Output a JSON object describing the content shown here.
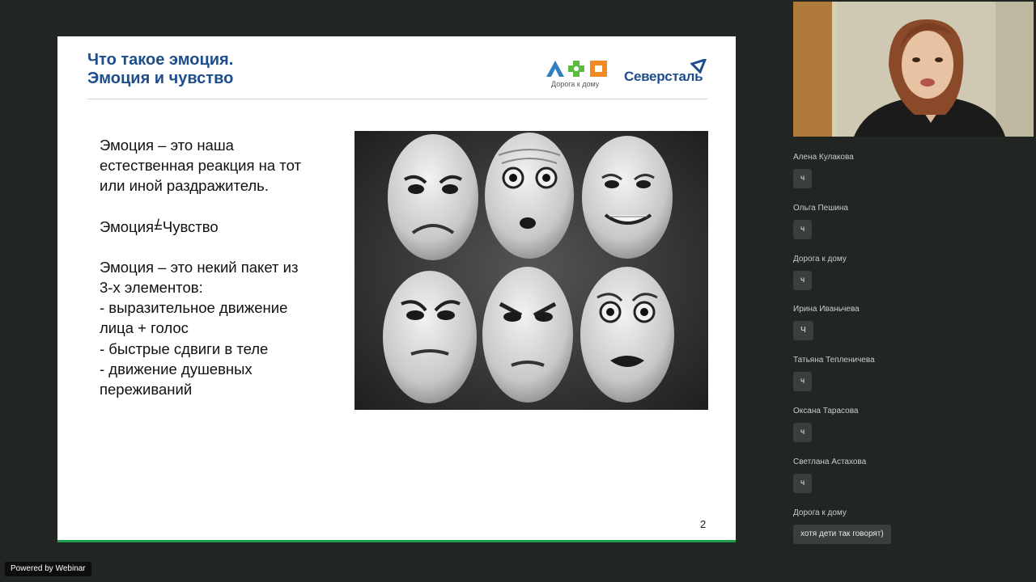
{
  "slide": {
    "title_line1": "Что такое эмоция.",
    "title_line2": "Эмоция и чувство",
    "logo_dkd_caption": "Дорога к дому",
    "logo_severstal": "Северсталь",
    "body": {
      "p1": [
        "Эмоция – это наша",
        "естественная реакция на тот",
        "или иной раздражитель."
      ],
      "p2_left": "Эмоция",
      "p2_sign": "=",
      "p2_slash": "/",
      "p2_right": "Чувство",
      "p3": [
        "Эмоция – это некий пакет из",
        "3-х элементов:",
        "-  выразительное движение",
        "лица + голос",
        "- быстрые сдвиги в теле",
        "- движение душевных",
        "переживаний"
      ]
    },
    "page_number": "2",
    "accent_color": "#20a04a",
    "title_color": "#1e4d8c"
  },
  "powered_by": "Powered by Webinar",
  "chat": {
    "messages": [
      {
        "author": "Алена Кулакова",
        "text": "ч"
      },
      {
        "author": "Ольга Пешина",
        "text": "ч"
      },
      {
        "author": "Дорога к дому",
        "text": "ч"
      },
      {
        "author": "Ирина Иваньчева",
        "text": "Ч"
      },
      {
        "author": "Татьяна Тепленичева",
        "text": "ч"
      },
      {
        "author": "Оксана Тарасова",
        "text": "ч"
      },
      {
        "author": "Светлана Астахова",
        "text": "ч"
      },
      {
        "author": "Дорога к дому",
        "text": "хотя дети так говорят)"
      }
    ]
  }
}
